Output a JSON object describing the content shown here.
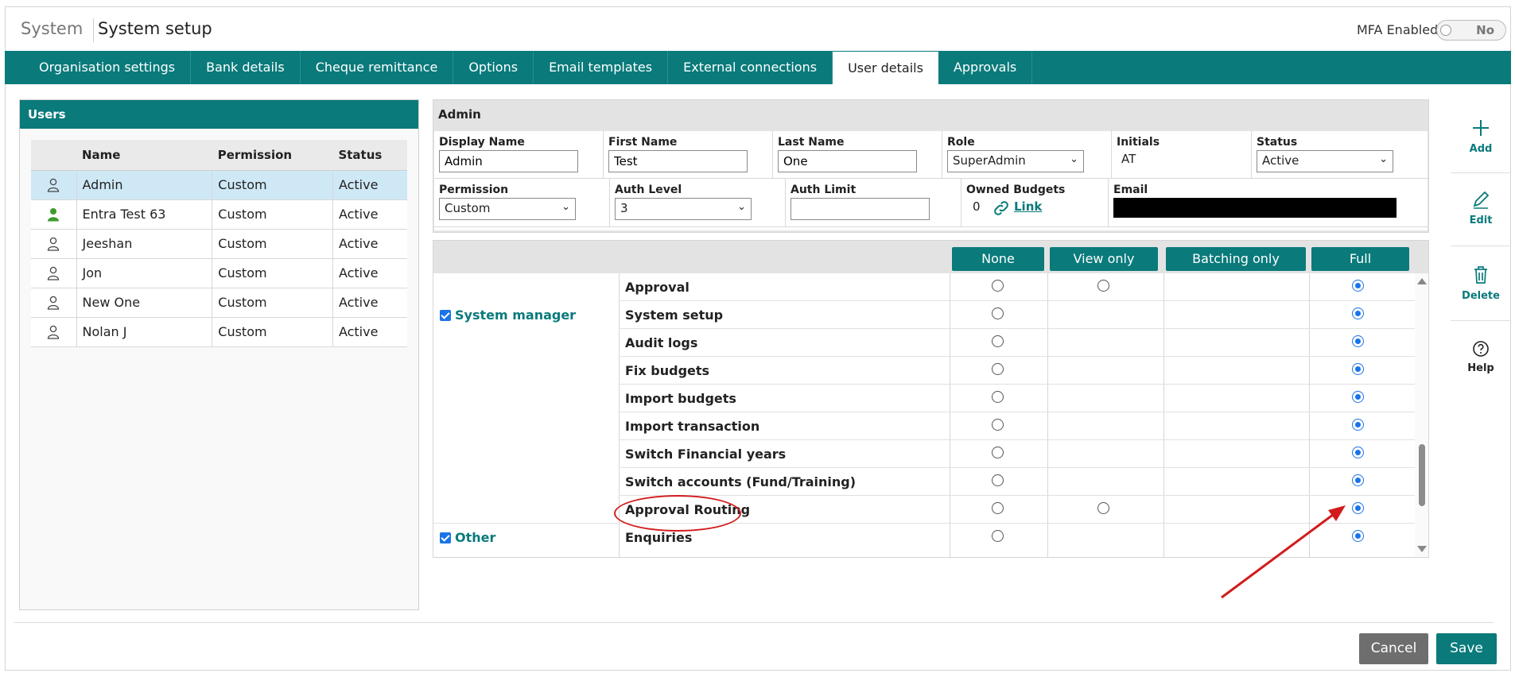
{
  "header": {
    "breadcrumb": "System",
    "title": "System setup",
    "mfa_label": "MFA Enabled",
    "mfa_value": "No"
  },
  "tabs": [
    {
      "label": "Organisation settings"
    },
    {
      "label": "Bank details"
    },
    {
      "label": "Cheque remittance"
    },
    {
      "label": "Options"
    },
    {
      "label": "Email templates"
    },
    {
      "label": "External connections"
    },
    {
      "label": "User details",
      "active": true
    },
    {
      "label": "Approvals"
    }
  ],
  "users": {
    "title": "Users",
    "columns": [
      "Name",
      "Permission",
      "Status"
    ],
    "rows": [
      {
        "name": "Admin",
        "permission": "Custom",
        "status": "Active",
        "selected": true,
        "icon": "person-outline-icon"
      },
      {
        "name": "Entra Test 63",
        "permission": "Custom",
        "status": "Active",
        "icon": "person-green-icon"
      },
      {
        "name": "Jeeshan",
        "permission": "Custom",
        "status": "Active",
        "icon": "person-outline-icon"
      },
      {
        "name": "Jon",
        "permission": "Custom",
        "status": "Active",
        "icon": "person-outline-icon"
      },
      {
        "name": "New One",
        "permission": "Custom",
        "status": "Active",
        "icon": "person-outline-icon"
      },
      {
        "name": "Nolan J",
        "permission": "Custom",
        "status": "Active",
        "icon": "person-outline-icon"
      }
    ]
  },
  "admin": {
    "title": "Admin",
    "display_name": {
      "label": "Display Name",
      "value": "Admin"
    },
    "first_name": {
      "label": "First Name",
      "value": "Test"
    },
    "last_name": {
      "label": "Last Name",
      "value": "One"
    },
    "role": {
      "label": "Role",
      "value": "SuperAdmin"
    },
    "initials": {
      "label": "Initials",
      "value": "AT"
    },
    "status": {
      "label": "Status",
      "value": "Active"
    },
    "permission": {
      "label": "Permission",
      "value": "Custom"
    },
    "auth_level": {
      "label": "Auth Level",
      "value": "3"
    },
    "auth_limit": {
      "label": "Auth Limit",
      "value": ""
    },
    "owned_budgets": {
      "label": "Owned Budgets",
      "count": "0",
      "link": "Link"
    },
    "email": {
      "label": "Email"
    }
  },
  "permissions": {
    "columns": [
      "None",
      "View only",
      "Batching only",
      "Full"
    ],
    "groups": [
      {
        "label": "System manager",
        "checked": true
      },
      {
        "label": "Other",
        "checked": true
      }
    ],
    "rows": [
      {
        "feature": "Approval",
        "selected": "Full"
      },
      {
        "feature": "System setup",
        "selected": "Full"
      },
      {
        "feature": "Audit logs",
        "selected": "Full"
      },
      {
        "feature": "Fix budgets",
        "selected": "Full"
      },
      {
        "feature": "Import budgets",
        "selected": "Full"
      },
      {
        "feature": "Import transaction",
        "selected": "Full"
      },
      {
        "feature": "Switch Financial years",
        "selected": "Full"
      },
      {
        "feature": "Switch accounts (Fund/Training)",
        "selected": "Full"
      },
      {
        "feature": "Approval Routing",
        "selected": "Full"
      },
      {
        "feature": "Enquiries",
        "selected": "Full"
      }
    ]
  },
  "side_actions": {
    "add": "Add",
    "edit": "Edit",
    "delete": "Delete",
    "help": "Help"
  },
  "footer": {
    "cancel": "Cancel",
    "save": "Save"
  },
  "colors": {
    "brand": "#0a7a7b",
    "selected_row": "#cfe8f6",
    "annotation": "#d21c1c",
    "radio": "#1a73e8"
  }
}
